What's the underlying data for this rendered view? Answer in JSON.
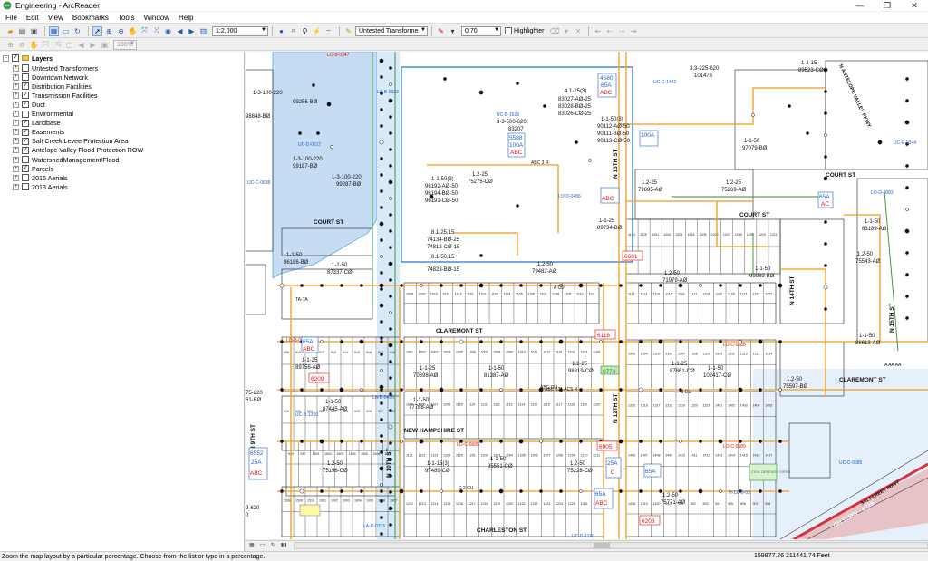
{
  "window": {
    "title": "Engineering - ArcReader",
    "minimize": "—",
    "maximize": "❐",
    "close": "✕"
  },
  "menu": [
    "File",
    "Edit",
    "View",
    "Bookmarks",
    "Tools",
    "Window",
    "Help"
  ],
  "toolbar": {
    "scale": "1:2,000",
    "layer_combo": "Untested Transforme",
    "line_width": "0.70",
    "highlighter_label": "Highlighter",
    "zoom_percent": "100%"
  },
  "toc": {
    "root": "Layers",
    "layers": [
      {
        "name": "Untested Transformers",
        "checked": false
      },
      {
        "name": "Downtown Network",
        "checked": false
      },
      {
        "name": "Distribution Facilities",
        "checked": true
      },
      {
        "name": "Transmission Facilities",
        "checked": true
      },
      {
        "name": "Duct",
        "checked": true
      },
      {
        "name": "Environmental",
        "checked": false
      },
      {
        "name": "Landbase",
        "checked": true
      },
      {
        "name": "Easements",
        "checked": true
      },
      {
        "name": "Salt Creek Levee Protection Area",
        "checked": true
      },
      {
        "name": "Antelope Valley Flood Protection ROW",
        "checked": true
      },
      {
        "name": "WatershedManagement/Flood",
        "checked": false
      },
      {
        "name": "Parcels",
        "checked": true
      },
      {
        "name": "2016 Aerials",
        "checked": false
      },
      {
        "name": "2013 Aerials",
        "checked": false
      }
    ]
  },
  "map": {
    "streets": {
      "court_w": "COURT ST",
      "court_c": "COURT ST",
      "court_e": "COURT ST",
      "claremont_c": "CLAREMONT ST",
      "claremont_e": "CLAREMONT ST",
      "new_hampshire": "NEW HAMPSHIRE ST",
      "charleston": "CHARLESTON ST",
      "n9th": "N 9TH ST",
      "n10th": "N 10TH ST",
      "n12th": "N 12TH ST",
      "n13th": "N 13TH ST",
      "n14th": "N 14TH ST",
      "n15th": "N 15TH ST",
      "antelope": "N ANTELOPE VALLEY PKWY",
      "salt_creek": "SALT CREEK RDWY"
    },
    "labels": {
      "lo_b_0347": "LO-B-0347",
      "t_1_3_100_220a": "1-3-100-220",
      "t_99256": "99256-BØ",
      "t_98848": "98848-BØ",
      "t_1_3_100_220b": "1-3-100-220",
      "t_99187": "99187-BØ",
      "t_1_3_100_220c": "1-3-100-220",
      "t_99287": "99287-BØ",
      "t_3_3_500_620": "3-3-500-620",
      "t_83207": "83207",
      "t_4_1_25": "4.1-25(3)",
      "t_83027": "83027-AØ-25",
      "t_83028": "83028-BØ-25",
      "t_83026": "83026-CØ-25",
      "t_1_1_50_3": "1-1-50(3)",
      "t_90112": "90112-AØ-50",
      "t_90111": "90111-BØ-50",
      "t_90113": "90113-CØ-50",
      "t_3_3_225_620": "3.3-225-620",
      "t_101473": "101473",
      "t_1_1_15": "1-1-15",
      "t_89523": "89523-CØ",
      "t_1_1_50b": "1-1-50",
      "t_97079": "97079-BØ",
      "t_1_1_50_3b": "1-1-50(3)",
      "t_96192": "96192-AØ-50",
      "t_96194": "96194-BØ-50",
      "t_96191": "96191-CØ-50",
      "t_1_2_25": "1.2-25",
      "t_75275": "75275-CØ",
      "t_1_2_25b": "1.2-25",
      "t_79685": "79685-AØ",
      "t_1_2_25c": "1.2-25",
      "t_75269": "75269-AØ",
      "t_8_1_25_15": "8.1-25,15",
      "t_74134": "74134-BØ-25",
      "t_74813": "74813-CØ-15",
      "t_8_1_50_15": "8.1-50,15",
      "t_74823": "74823-BØ-15",
      "t_1_1_25": "1-1-25",
      "t_89734": "89734-BØ",
      "t_1_2_50": "1.2-50",
      "t_79482": "79482-AØ",
      "t_1_2_50b": "1.2-50",
      "t_71979": "71979-AØ",
      "t_1_1_50c": "1-1-50",
      "t_99989": "99989-BØ",
      "t_1_1_50d": "1-1-50",
      "t_83189": "83189-AØ",
      "t_1_2_50c": "1.2-50",
      "t_75543": "75543-AØ",
      "t_1_1_50e": "1-1-50",
      "t_86613": "86613-AØ",
      "t_1_1_50f": "1-1-50",
      "t_87337": "87337-CØ",
      "t_1_1_50g": "1-1-50",
      "t_86186": "86186-BØ",
      "t_1_1_25b": "1-1-25",
      "t_89756": "89756-AØ",
      "t_1_1_25c": "1-1-25",
      "t_70698": "70698-AØ",
      "t_1_1_50h": "1-1-50",
      "t_81387": "81387-AØ",
      "t_1_2_25d": "1.2-25",
      "t_98319": "98319-CØ",
      "t_1_1_25d": "1-1-25",
      "t_87861": "87861-CØ",
      "t_1_1_50i": "1-1-50",
      "t_102417": "102417-CØ",
      "t_1_2_50d": "1.2-50",
      "t_75597": "75597-BØ",
      "t_1_1_50j": "1-1-50",
      "t_87445": "87445-AØ",
      "t_1_1_50k": "1-1-50",
      "t_77788": "77788-AØ",
      "t_1_2_50e": "1.2-50",
      "t_75196": "75196-CØ",
      "t_1_1_15_3": "1-1-15(3)",
      "t_97489": "97489-CØ",
      "t_1_1_50l": "1-1-50",
      "t_95551": "95551-CØ",
      "t_1_2_50f": "1.2-50",
      "t_75228": "75228-CØ",
      "t_1_2_50g": "1.2-50",
      "t_75771": "75771-AØ",
      "t_75_220": "75-220",
      "t_61": "61-BØ",
      "t_9_620": "9-620",
      "t_0": "0",
      "b_4580": "4580",
      "b_65a_top": "65A",
      "b_abc_top": "ABC",
      "b_5588": "5588",
      "b_100a": "100A",
      "b_abc2": "ABC",
      "b_100a2": "100A",
      "b_abc3": "ABC",
      "b_65a_w": "65A",
      "b_abc_w": "ABC",
      "b_65a_e": "65A",
      "b_ac_e": "AC",
      "b_6552": "6552",
      "b_25a": "25A",
      "b_abc_sw": "ABC",
      "b_25a_s": "25A",
      "b_c": "C",
      "b_65a_se": "65A",
      "b_abc_s": "ABC",
      "b_65a_mid": "65A",
      "r_6601": "6601",
      "r_6118": "6118",
      "r_6209": "6209",
      "r_6905": "6905",
      "r_6208": "6208",
      "g_0774": "0774",
      "uc_c_1442": "UC-C-1442",
      "uc_b_1629": "UC-B-1629",
      "lo_d_0486": "LO-D-0486",
      "uc_d_0617": "UC-D-0617",
      "uc_c_0698": "UC-C-0698",
      "lo_b_0347b": "LO-B-0347",
      "la_b_0322": "LA-B-0322",
      "lo_c_0688": "LO-C-0688",
      "lo_d_0082": "LO-D-0082",
      "uc_e_0344": "UC-E-0344",
      "lo_c_0685": "LO-C-0685",
      "lo_c_0689": "LO-C-0689",
      "uc_c_0685": "UC-C-0685",
      "uc_b_1350": "UC-B-1350",
      "la_b_0456": "LA-B-0456",
      "la_d_0315": "LA-D-0315",
      "uc_d_1110": "UC-D-1110",
      "h_12f9_03": "H-12F9-03",
      "civil_defense": "CIVIL DEFENSE SIREN",
      "ta_ta": "TA-TA",
      "abc_cu": "ABC CU",
      "a_cu": "A CU",
      "b_cu": "B CU",
      "c_cu": "C 2 CU",
      "abc_sr": "ABC 3 R",
      "abc_cu2": "ABC 331 ACS R",
      "oh_115kv": "OH 115Kv - L719",
      "aa_aa": "A AA AA"
    },
    "lot_numbers": [
      "1001",
      "1002",
      "1003",
      "1004",
      "1005",
      "1006",
      "1007",
      "1008",
      "1009",
      "1010",
      "1011",
      "1012",
      "1101",
      "1102",
      "1103",
      "1104",
      "1105",
      "1106",
      "1107",
      "1108",
      "1109",
      "1110",
      "1111",
      "1112",
      "1113",
      "1114",
      "1115",
      "1116",
      "1117",
      "1118",
      "1119",
      "1120",
      "1121",
      "1122",
      "1123",
      "1124",
      "1125",
      "1201",
      "1202",
      "1203",
      "1204",
      "1205",
      "1206",
      "1207",
      "1208",
      "1209",
      "1210",
      "1211",
      "1212",
      "1213",
      "1214",
      "1215",
      "1216",
      "1217",
      "1218",
      "1219",
      "1220",
      "1221",
      "1222",
      "1223",
      "1224",
      "1225",
      "1301",
      "1302",
      "1303",
      "1304",
      "1305",
      "1306",
      "1307",
      "1308",
      "1309",
      "1310",
      "1311",
      "1312",
      "1313",
      "1314",
      "1315",
      "1316",
      "1317",
      "1318",
      "1319",
      "1320",
      "1321",
      "1401",
      "1402",
      "1403",
      "1404",
      "1405",
      "1406",
      "1407",
      "1408",
      "1409",
      "1410",
      "1411",
      "1412",
      "1413",
      "1414",
      "1415",
      "1416",
      "1417",
      "1418",
      "1419",
      "1420",
      "1421",
      "901",
      "902",
      "903",
      "904",
      "905",
      "906",
      "907",
      "908",
      "909",
      "910",
      "911",
      "912",
      "913",
      "914",
      "915",
      "916",
      "917",
      "918",
      "919",
      "920",
      "921",
      "922",
      "923",
      "924",
      "925",
      "926",
      "927",
      "928",
      "929",
      "930",
      "1501",
      "1502",
      "1503",
      "1504",
      "1505",
      "1506",
      "1507",
      "1508",
      "1509",
      "1510"
    ]
  },
  "status": {
    "message": "Zoom the map layout by a particular percentage. Choose from the list or type in a percentage.",
    "coordinates": "159877.26  211441.74 Feet"
  },
  "colors": {
    "flood": "#c3dcf2",
    "primary": "#f29b1d",
    "secondary": "#2f8c3a",
    "blue_label": "#1f5fcf",
    "red_label": "#e01010",
    "rail": "#e24a5a"
  },
  "icons": {
    "app": "arcreader-globe-icon"
  }
}
